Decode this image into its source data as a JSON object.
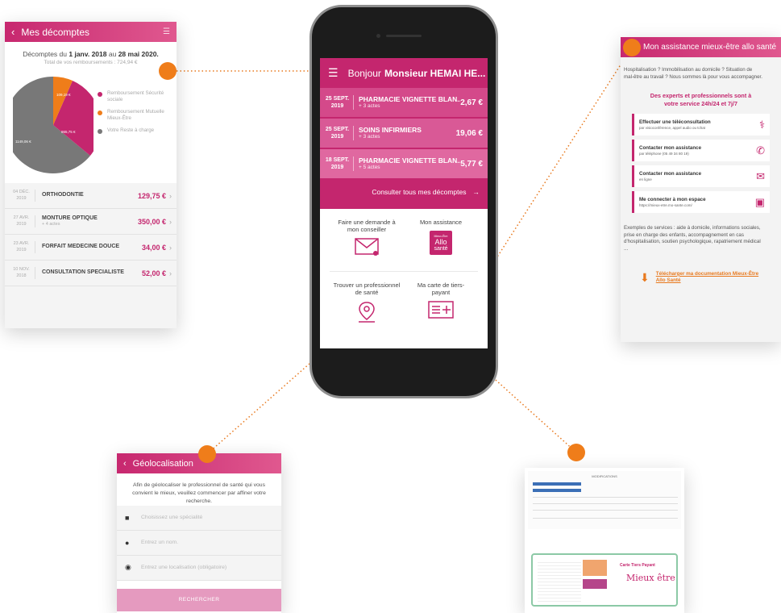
{
  "colors": {
    "brand_pink": "#c4266e",
    "accent_orange": "#ef7d1a",
    "social_security": "#c4266e",
    "mutuelle": "#ef7d1a",
    "remaining": "#777777"
  },
  "decomptes": {
    "title": "Mes décomptes",
    "period_prefix": "Décomptes du",
    "period_start": "1 janv. 2018",
    "period_mid": "au",
    "period_end": "28 mai 2020.",
    "total": "Total de vos remboursements : 724,94 €",
    "pie": {
      "orange_label": "109,19 €",
      "pink_label": "865,75 €",
      "grey_label": "1149,06 €"
    },
    "legend": [
      {
        "label": "Remboursement Sécurité sociale"
      },
      {
        "label": "Remboursement Mutuelle Mieux-Être"
      },
      {
        "label": "Votre Reste à charge"
      }
    ],
    "rows": [
      {
        "date": "04 DÉC.",
        "year": "2019",
        "label": "ORTHODONTIE",
        "sub": "",
        "amount": "129,75 €"
      },
      {
        "date": "27 AVR.",
        "year": "2019",
        "label": "MONTURE OPTIQUE",
        "sub": "+ 4 actes",
        "amount": "350,00 €"
      },
      {
        "date": "23 AVR.",
        "year": "2019",
        "label": "FORFAIT MEDECINE DOUCE",
        "sub": "",
        "amount": "34,00 €"
      },
      {
        "date": "10 NOV.",
        "year": "2018",
        "label": "CONSULTATION SPECIALISTE",
        "sub": "",
        "amount": "52,00 €"
      }
    ]
  },
  "phone": {
    "greeting": "Bonjour",
    "user": "Monsieur HEMAI HE...",
    "rows": [
      {
        "date": "25 SEPT.",
        "year": "2019",
        "label": "PHARMACIE VIGNETTE BLAN...",
        "sub": "+ 3 actes",
        "amount": "2,67 €"
      },
      {
        "date": "25 SEPT.",
        "year": "2019",
        "label": "SOINS INFIRMIERS",
        "sub": "+ 3 actes",
        "amount": "19,06 €"
      },
      {
        "date": "18 SEPT.",
        "year": "2019",
        "label": "PHARMACIE VIGNETTE BLAN...",
        "sub": "+ 5 actes",
        "amount": "5,77 €"
      }
    ],
    "see_all": "Consulter tous mes décomptes",
    "tiles": [
      {
        "label": "Faire une demande à mon conseiller"
      },
      {
        "label": "Mon assistance"
      },
      {
        "label": "Trouver un professionnel de santé"
      },
      {
        "label": "Ma carte de tiers-payant"
      }
    ],
    "allo_top": "Mieux-Être",
    "allo_main": "Allo",
    "allo_bottom": "santé"
  },
  "assistance": {
    "title": "Mon assistance mieux-être allo santé",
    "intro_1": "Hospitalisation ? Immobilisation au domicile ? Situation de",
    "intro_2": "mal-être au travail ? Nous sommes là pour vous accompagner.",
    "experts_1": "Des experts et professionnels sont à",
    "experts_2": "votre service 24h/24 et 7j/7",
    "cards": [
      {
        "title": "Effectuer une téléconsultation",
        "sub": "par visioconférence, appel audio ou tchat"
      },
      {
        "title": "Contacter mon assistance",
        "sub": "par téléphone (05 49 34 80 19)"
      },
      {
        "title": "Contacter mon assistance",
        "sub": "en ligne"
      },
      {
        "title": "Me connecter à mon espace",
        "sub": "https://mieux-etre.mo-sante.com/"
      }
    ],
    "services_1": "Exemples de services : aide à domicile, informations sociales,",
    "services_2": "prise en charge des enfants, accompagnement en cas",
    "services_3": "d'hospitalisation, soutien psychologique, rapatriement médical",
    "services_4": "...",
    "download_1": "Télécharger ma documentation Mieux-Être",
    "download_2": "Allo Santé"
  },
  "geo": {
    "title": "Géolocalisation",
    "intro": "Afin de géolocaliser le professionnel de santé qui vous convient le mieux, veuillez commencer par affiner votre recherche.",
    "specialty_placeholder": "Choisissez une spécialité",
    "name_placeholder": "Entrez un nom.",
    "location_placeholder": "Entrez une localisation (obligatoire)",
    "button": "RECHERCHER"
  },
  "card": {
    "doc_title": "MODIFICATIONS",
    "card_title": "Carte Tiers Payant",
    "brand": "Mieux être"
  }
}
